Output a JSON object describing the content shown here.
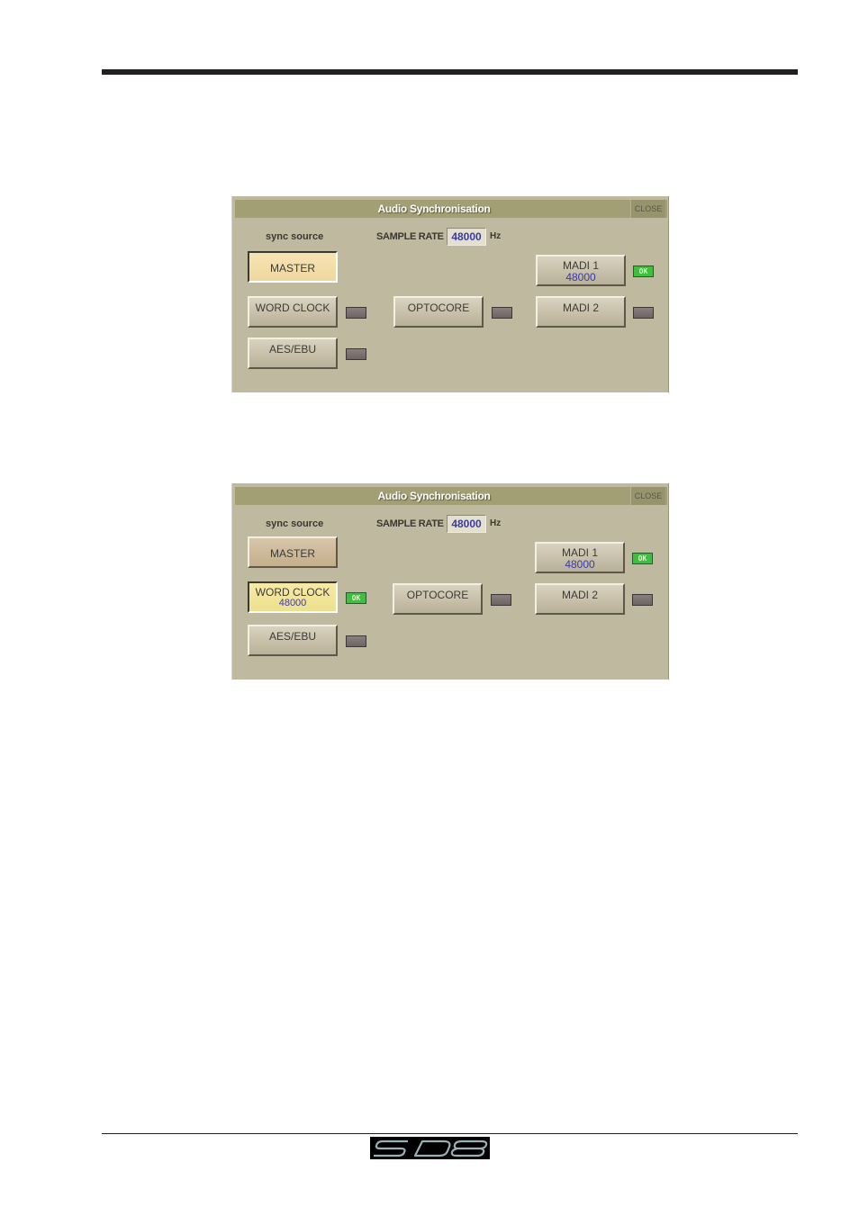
{
  "page": {
    "logo_text": "SD8"
  },
  "dialogs": [
    {
      "title": "Audio Synchronisation",
      "close_label": "CLOSE",
      "sync_source_label": "sync source",
      "sample_rate_label": "SAMPLE RATE",
      "sample_rate_value": "48000",
      "sample_rate_unit": "Hz",
      "selected_source": "MASTER",
      "sources": {
        "master": {
          "label": "MASTER",
          "rate": "",
          "status": ""
        },
        "word_clock": {
          "label": "WORD CLOCK",
          "rate": "",
          "status": ""
        },
        "aes_ebu": {
          "label": "AES/EBU",
          "rate": "",
          "status": ""
        },
        "optocore": {
          "label": "OPTOCORE",
          "rate": "",
          "status": ""
        },
        "madi1": {
          "label": "MADI 1",
          "rate": "48000",
          "status": "OK"
        },
        "madi2": {
          "label": "MADI 2",
          "rate": "",
          "status": ""
        }
      }
    },
    {
      "title": "Audio Synchronisation",
      "close_label": "CLOSE",
      "sync_source_label": "sync source",
      "sample_rate_label": "SAMPLE RATE",
      "sample_rate_value": "48000",
      "sample_rate_unit": "Hz",
      "selected_source": "WORD CLOCK",
      "sources": {
        "master": {
          "label": "MASTER",
          "rate": "",
          "status": ""
        },
        "word_clock": {
          "label": "WORD CLOCK",
          "rate": "48000",
          "status": "OK"
        },
        "aes_ebu": {
          "label": "AES/EBU",
          "rate": "",
          "status": ""
        },
        "optocore": {
          "label": "OPTOCORE",
          "rate": "",
          "status": ""
        },
        "madi1": {
          "label": "MADI 1",
          "rate": "48000",
          "status": "OK"
        },
        "madi2": {
          "label": "MADI 2",
          "rate": "",
          "status": ""
        }
      }
    }
  ]
}
